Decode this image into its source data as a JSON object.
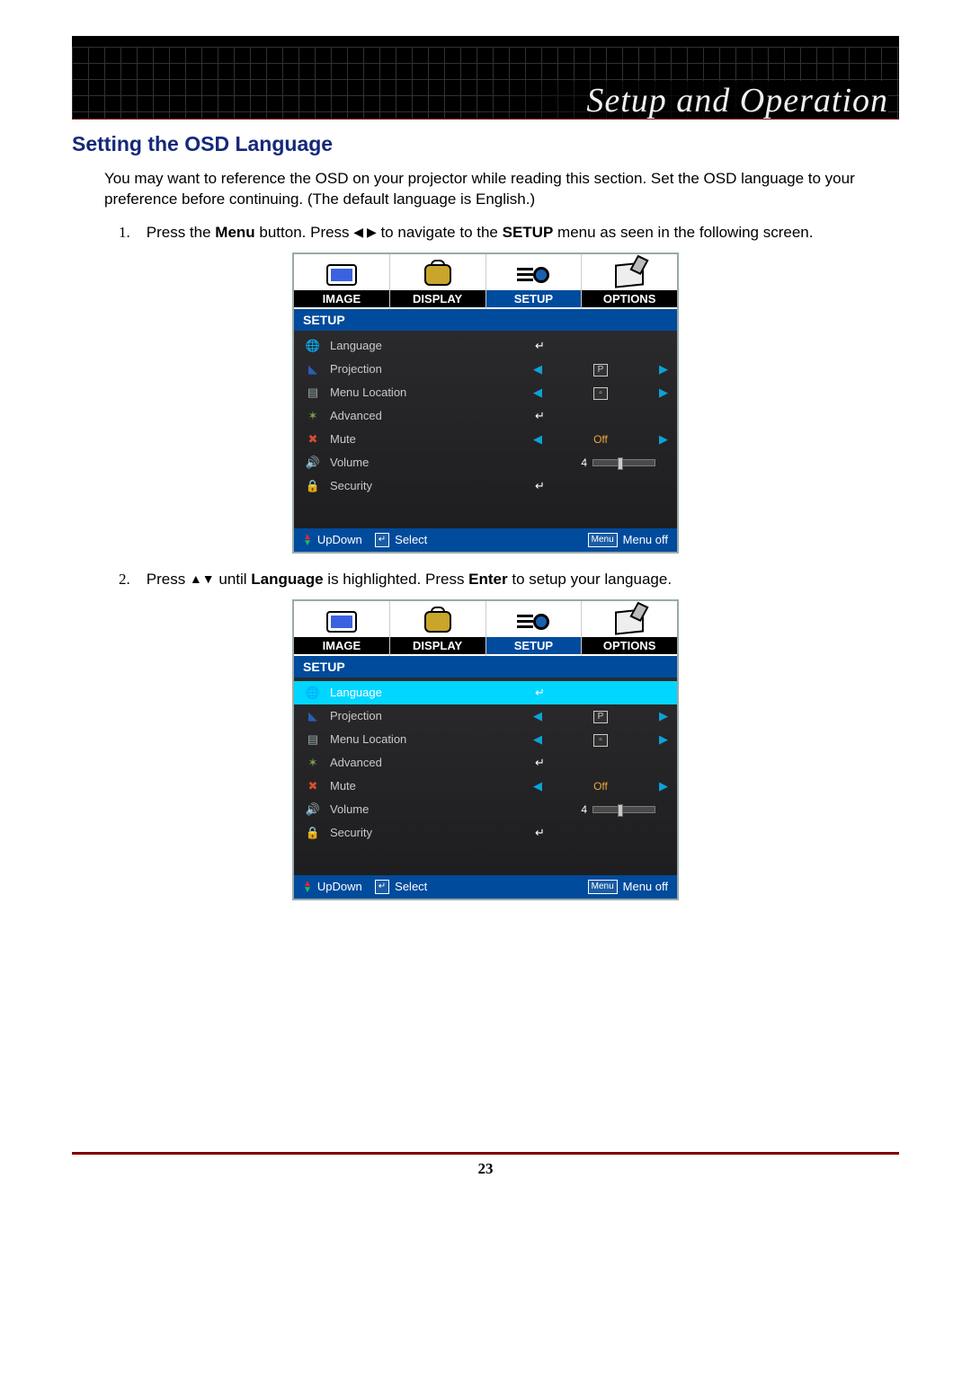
{
  "header": {
    "title": "Setup and Operation"
  },
  "section_heading": "Setting the OSD Language",
  "intro": "You may want to reference the OSD on your projector while reading this section. Set the OSD language to your preference before continuing. (The default language is English.)",
  "steps": [
    {
      "num": "1.",
      "pre": "Press the ",
      "bold1": "Menu",
      "mid": " button. Press ",
      "arrows": "◀ ▶",
      "mid2": " to navigate to the ",
      "bold2": "SETUP",
      "post": " menu as seen in the following screen."
    },
    {
      "num": "2.",
      "pre": "Press ",
      "arrows": "▲▼",
      "mid": " until ",
      "bold1": "Language",
      "mid2": " is highlighted. Press ",
      "bold2": "Enter",
      "post": " to setup your language."
    }
  ],
  "osd": {
    "tabs": [
      "IMAGE",
      "DISPLAY",
      "SETUP",
      "OPTIONS"
    ],
    "active_tab_index": 2,
    "subtitle": "SETUP",
    "rows": [
      {
        "icon": "globe",
        "label": "Language",
        "type": "enter"
      },
      {
        "icon": "proj",
        "label": "Projection",
        "type": "lr",
        "mid_html": "P",
        "mid_kind": "box"
      },
      {
        "icon": "menu",
        "label": "Menu Location",
        "type": "lr",
        "mid_html": "▫",
        "mid_kind": "box"
      },
      {
        "icon": "adv",
        "label": "Advanced",
        "type": "enter"
      },
      {
        "icon": "mute",
        "label": "Mute",
        "type": "lr",
        "mid_html": "Off",
        "mid_kind": "orange"
      },
      {
        "icon": "vol",
        "label": "Volume",
        "type": "slider",
        "value": "4",
        "value_pct": 40
      },
      {
        "icon": "sec",
        "label": "Security",
        "type": "enter"
      }
    ],
    "footer": {
      "updown": "UpDown",
      "select": "Select",
      "menu_key": "Menu",
      "menu_off": "Menu off"
    }
  },
  "osd_screens": [
    {
      "highlight_index": -1
    },
    {
      "highlight_index": 0
    }
  ],
  "page_number": "23"
}
